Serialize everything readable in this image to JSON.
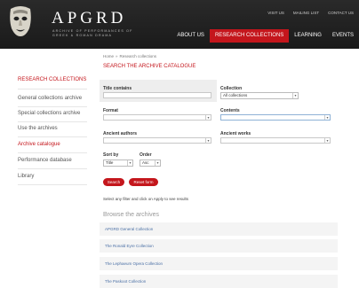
{
  "header": {
    "logo_text": "APGRD",
    "logo_subtitle": "Archive of Performances of Greek & Roman Drama",
    "top_links": [
      "VISIT US",
      "MAILING LIST",
      "CONTACT US"
    ],
    "nav": [
      {
        "label": "ABOUT US",
        "active": false
      },
      {
        "label": "RESEARCH COLLECTIONS",
        "active": true
      },
      {
        "label": "LEARNING",
        "active": false
      },
      {
        "label": "EVENTS",
        "active": false
      }
    ]
  },
  "sidebar": {
    "title": "RESEARCH COLLECTIONS",
    "items": [
      {
        "label": "General collections archive",
        "active": false
      },
      {
        "label": "Special collections archive",
        "active": false
      },
      {
        "label": "Use the archives",
        "active": false
      },
      {
        "label": "Archive catalogue",
        "active": true
      },
      {
        "label": "Performance database",
        "active": false
      },
      {
        "label": "Library",
        "active": false
      }
    ]
  },
  "breadcrumb": {
    "home": "Home",
    "separator": "»",
    "current": "Research collections"
  },
  "form": {
    "title": "SEARCH THE ARCHIVE CATALOGUE",
    "title_contains_label": "Title contains",
    "title_contains_value": "",
    "collection_label": "Collection",
    "collection_value": "All collections",
    "format_label": "Format",
    "contents_label": "Contents",
    "ancient_authors_label": "Ancient authors",
    "ancient_works_label": "Ancient works",
    "sort_by_label": "Sort by",
    "sort_by_value": "Title",
    "order_label": "Order",
    "order_value": "Asc",
    "search_button": "Search",
    "reset_button": "Reset form",
    "hint": "Select any filter and click on Apply to see results"
  },
  "browse": {
    "title": "Browse the archives",
    "items": [
      "APGRD General Collection",
      "The Ronald Eyre Collection",
      "The Lephaeum Opera Collection",
      "The Paskoot Collection"
    ]
  },
  "colors": {
    "accent": "#c4161c",
    "header_bg": "#1f1f1f",
    "link": "#4a6fa5"
  },
  "icons": {
    "logo": "theatre-mask-icon",
    "dropdown": "chevron-down-icon"
  }
}
